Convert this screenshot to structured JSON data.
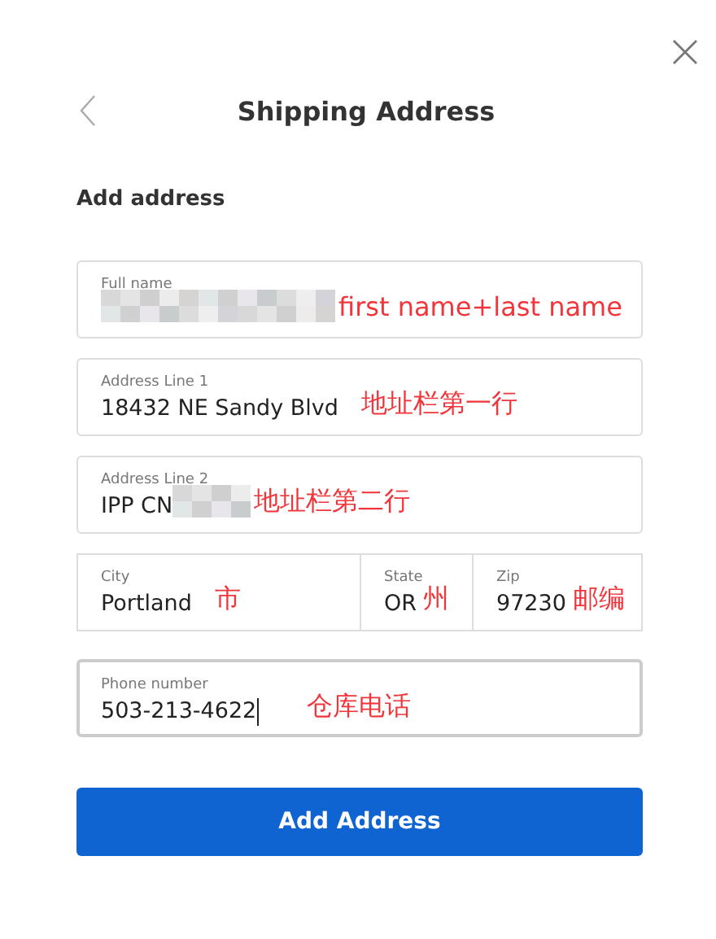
{
  "header": {
    "title": "Shipping Address"
  },
  "section_title": "Add address",
  "rows": [
    {
      "fields": [
        {
          "label": "Full name",
          "blurred": true,
          "focused": false,
          "annotation": "first name+last name"
        }
      ]
    },
    {
      "fields": [
        {
          "label": "Address Line 1",
          "value": "18432 NE Sandy Blvd",
          "blurred": false,
          "focused": false,
          "annotation": "地址栏第一行"
        }
      ]
    },
    {
      "fields": [
        {
          "label": "Address Line 2",
          "value": "IPP CN",
          "blurred": true,
          "focused": false,
          "annotation": "地址栏第二行"
        }
      ]
    },
    {
      "fields": [
        {
          "label": "City",
          "value": "Portland",
          "blurred": false,
          "focused": false,
          "annotation": "市"
        },
        {
          "label": "State",
          "value": "OR",
          "blurred": false,
          "focused": false,
          "annotation": "州"
        },
        {
          "label": "Zip",
          "value": "97230",
          "blurred": false,
          "focused": false,
          "annotation": "邮编"
        }
      ]
    },
    {
      "fields": [
        {
          "label": "Phone number",
          "value": "503-213-4622",
          "blurred": false,
          "focused": true,
          "annotation": "仓库电话"
        }
      ]
    }
  ],
  "submit_button": "Add Address"
}
